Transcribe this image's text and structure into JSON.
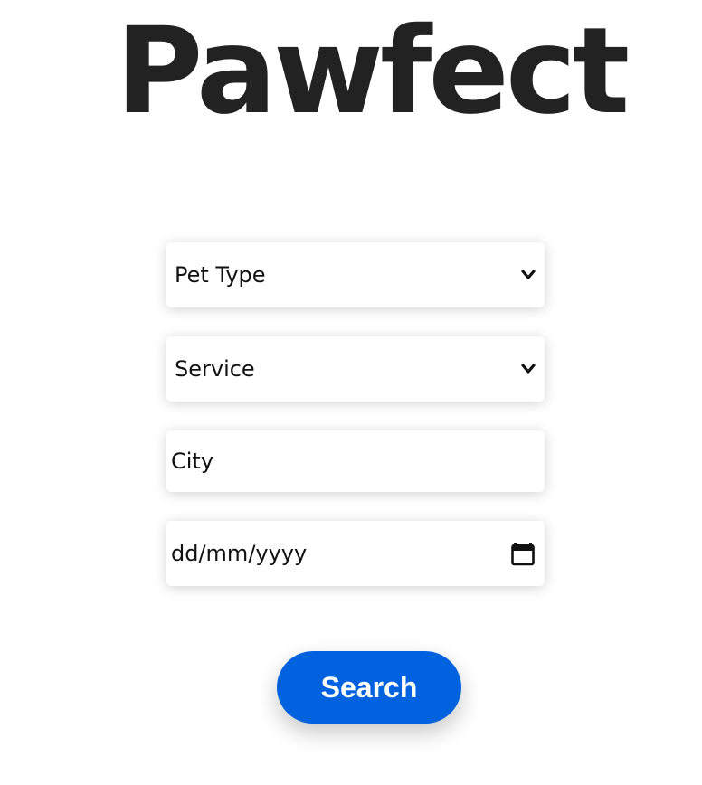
{
  "app": {
    "title": "Pawfect"
  },
  "form": {
    "pet_type": {
      "label": "Pet Type",
      "icon": "chevron-down-icon"
    },
    "service": {
      "label": "Service",
      "icon": "chevron-down-icon"
    },
    "city": {
      "placeholder": "City"
    },
    "date": {
      "placeholder": "dd/mm/yyyy",
      "icon": "calendar-icon"
    },
    "search_label": "Search"
  },
  "colors": {
    "title": "#222222",
    "button": "#0062de",
    "button_text": "#ffffff"
  }
}
